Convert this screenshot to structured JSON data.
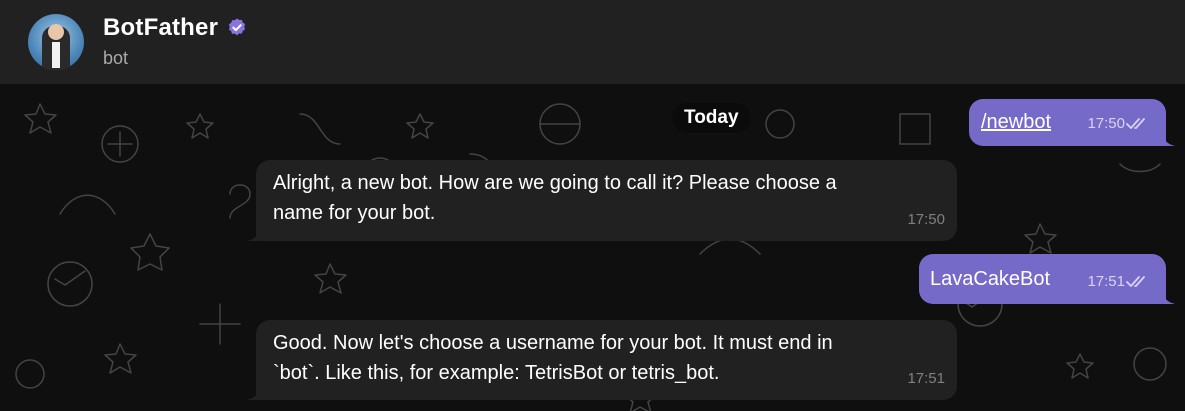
{
  "header": {
    "title": "BotFather",
    "subtitle": "bot"
  },
  "chat": {
    "date_chip": "Today",
    "messages": [
      {
        "direction": "outgoing",
        "text": "/newbot",
        "time": "17:50"
      },
      {
        "direction": "incoming",
        "text_line1": "Alright, a new bot. How are we going to call it? Please choose a",
        "text_line2": "name for your bot.",
        "time": "17:50"
      },
      {
        "direction": "outgoing",
        "text": "LavaCakeBot",
        "time": "17:51"
      },
      {
        "direction": "incoming",
        "text_line1": "Good. Now let's choose a username for your bot. It must end in",
        "text_line2": "`bot`. Like this, for example: TetrisBot or tetris_bot.",
        "time": "17:51"
      }
    ]
  },
  "colors": {
    "header_bg": "#212121",
    "chat_bg": "#0f0f0f",
    "incoming_bubble": "#212121",
    "outgoing_bubble": "#766ac8",
    "verified_badge": "#8774e1",
    "muted_text": "#aaaaaa"
  },
  "icons": {
    "verified": "verified-badge-icon",
    "read_receipt": "double-check-icon"
  }
}
